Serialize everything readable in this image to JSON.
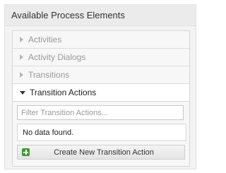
{
  "panel": {
    "title": "Available Process Elements"
  },
  "accordion": {
    "items": [
      {
        "label": "Activities"
      },
      {
        "label": "Activity Dialogs"
      },
      {
        "label": "Transitions"
      },
      {
        "label": "Transition Actions"
      }
    ]
  },
  "transition_actions": {
    "filter_placeholder": "Filter Transition Actions...",
    "empty_message": "No data found.",
    "create_button_label": "Create New Transition Action",
    "create_icon": "plus-icon"
  }
}
